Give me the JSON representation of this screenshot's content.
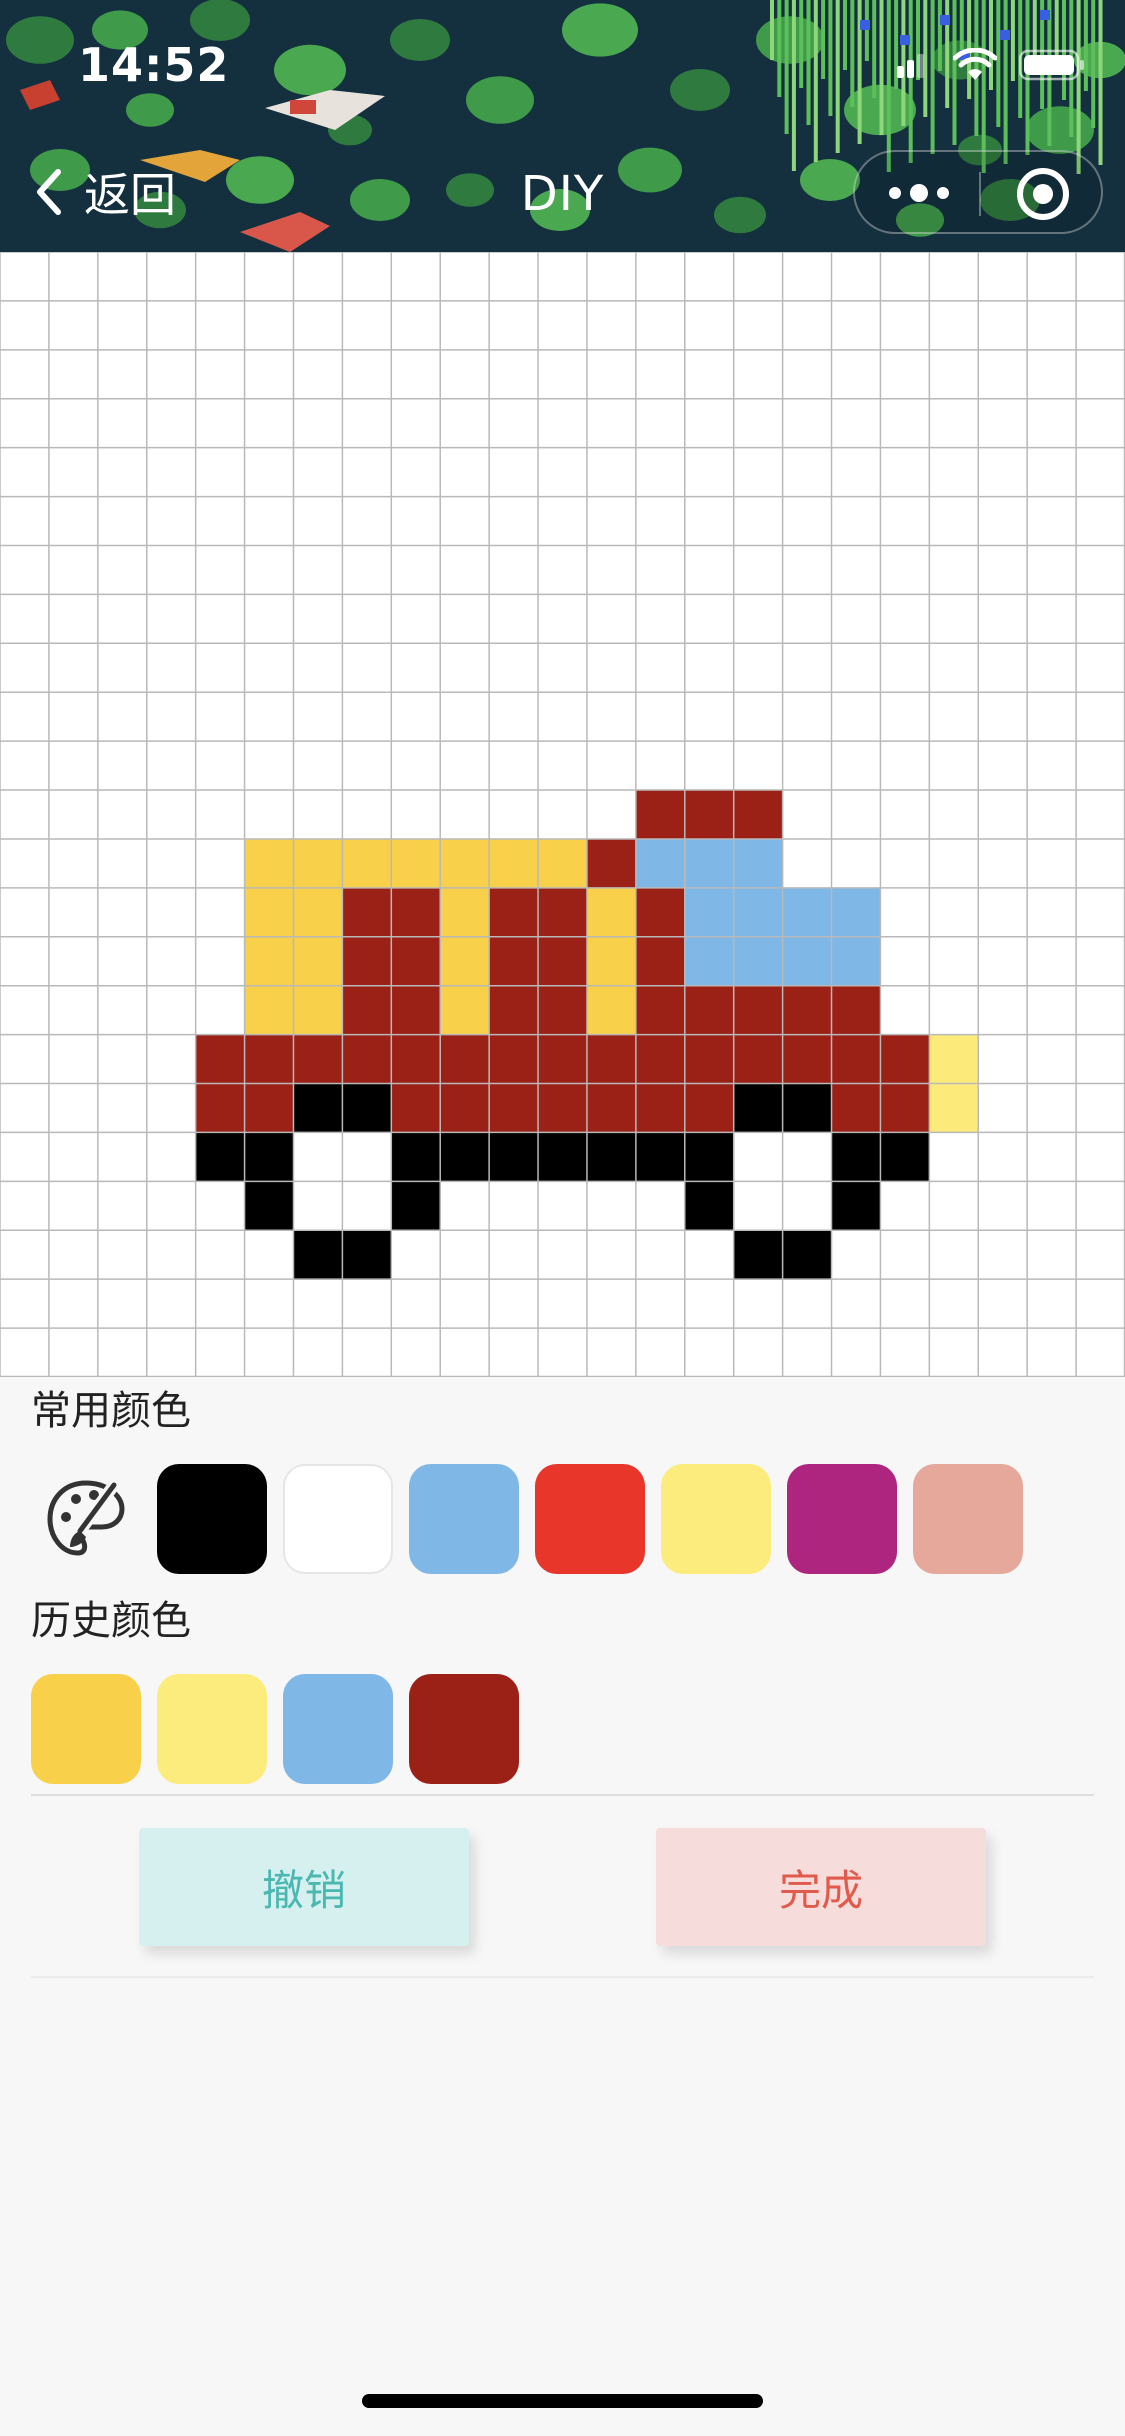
{
  "status_bar": {
    "time": "14:52"
  },
  "nav": {
    "back_label": "返回",
    "title": "DIY"
  },
  "grid": {
    "cols": 23,
    "rows": 23,
    "line_color": "#b9b9b9",
    "palette": {
      "Y": "#f8d04a",
      "R": "#9b2016",
      "B": "#7fb7e6",
      "K": "#000000",
      "L": "#fceb7a"
    },
    "pixels": [
      ".......................",
      ".......................",
      ".......................",
      ".......................",
      ".......................",
      ".......................",
      ".......................",
      ".......................",
      ".......................",
      ".......................",
      ".......................",
      ".............RRR.......",
      ".....YYYYYYYRBBB.......",
      ".....YYRRYRRYRBBBB.....",
      ".....YYRRYRRYRBBBB.....",
      ".....YYRRYRRYRRRRR.....",
      "....RRRRRRRRRRRRRRRL...",
      "....RRKKRRRRRRRKKRRL...",
      "....KK..KKKKKKK..KK....",
      ".....K..K.....K..K.....",
      "......KK.......KK......",
      ".......................",
      "......................."
    ]
  },
  "palette": {
    "common_label": "常用颜色",
    "common_colors": [
      "#000000",
      "#ffffff",
      "#7fb7e6",
      "#e8362b",
      "#fcec7d",
      "#ad257e",
      "#e5a89a"
    ],
    "history_label": "历史颜色",
    "history_colors": [
      "#f8d04a",
      "#fcec7d",
      "#7fb7e6",
      "#9b2016"
    ]
  },
  "actions": {
    "undo_label": "撤销",
    "done_label": "完成"
  },
  "icons": {
    "back": "chevron-left-icon",
    "more": "more-dots-icon",
    "close_target": "target-circle-icon",
    "palette": "palette-brush-icon"
  }
}
